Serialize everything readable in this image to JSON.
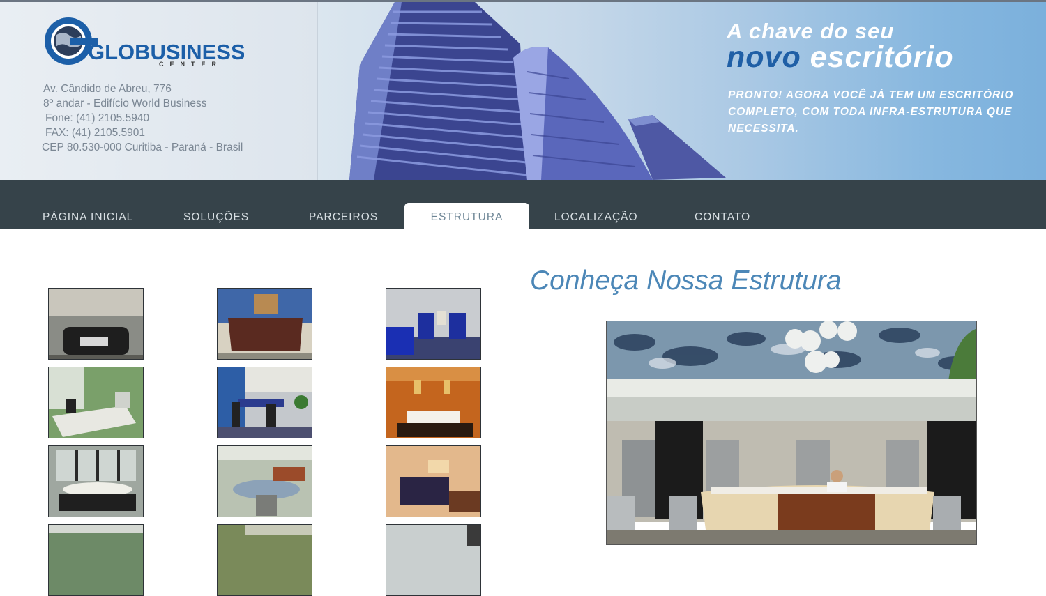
{
  "logo": {
    "name": "GLOBUSINESS",
    "sub": "CENTER"
  },
  "address": [
    "Av. Cândido de Abreu, 776",
    "8º andar - Edifício World Business",
    "Fone: (41) 2105.5940",
    "FAX: (41) 2105.5901",
    "CEP 80.530-000  Curitiba - Paraná - Brasil"
  ],
  "hero": {
    "line1": "A chave do seu",
    "line2a": "novo",
    "line2b": "escritório",
    "tagline": "PRONTO! AGORA VOCÊ JÁ TEM UM ESCRITÓRIO COMPLETO, COM TODA INFRA-ESTRUTURA QUE NECESSITA."
  },
  "nav": {
    "items": [
      "PÁGINA INICIAL",
      "SOLUÇÕES",
      "PARCEIROS",
      "ESTRUTURA",
      "LOCALIZAÇÃO",
      "CONTATO"
    ],
    "active": "ESTRUTURA"
  },
  "main": {
    "title": "Conheça Nossa Estrutura"
  },
  "colors": {
    "nav_bg": "#36434a",
    "title": "#4c87b7",
    "brand_blue": "#1f5fa6"
  }
}
